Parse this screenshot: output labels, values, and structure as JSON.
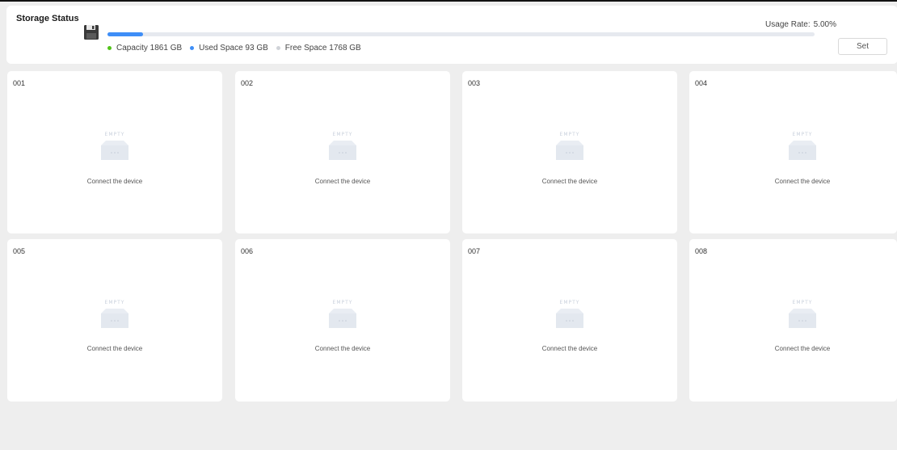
{
  "storage": {
    "title": "Storage Status",
    "usage_rate_label": "Usage Rate:",
    "usage_rate_value": "5.00%",
    "usage_fraction": 0.05,
    "legend": {
      "capacity": "Capacity 1861 GB",
      "used": "Used Space 93 GB",
      "free": "Free Space 1768 GB"
    },
    "set_label": "Set",
    "colors": {
      "capacity": "#52c41a",
      "used": "#3e8ef7",
      "free": "#d0d3d8"
    }
  },
  "slots": [
    {
      "id": "001",
      "empty_label": "EMPTY",
      "message": "Connect the device"
    },
    {
      "id": "002",
      "empty_label": "EMPTY",
      "message": "Connect the device"
    },
    {
      "id": "003",
      "empty_label": "EMPTY",
      "message": "Connect the device"
    },
    {
      "id": "004",
      "empty_label": "EMPTY",
      "message": "Connect the device"
    },
    {
      "id": "005",
      "empty_label": "EMPTY",
      "message": "Connect the device"
    },
    {
      "id": "006",
      "empty_label": "EMPTY",
      "message": "Connect the device"
    },
    {
      "id": "007",
      "empty_label": "EMPTY",
      "message": "Connect the device"
    },
    {
      "id": "008",
      "empty_label": "EMPTY",
      "message": "Connect the device"
    }
  ]
}
